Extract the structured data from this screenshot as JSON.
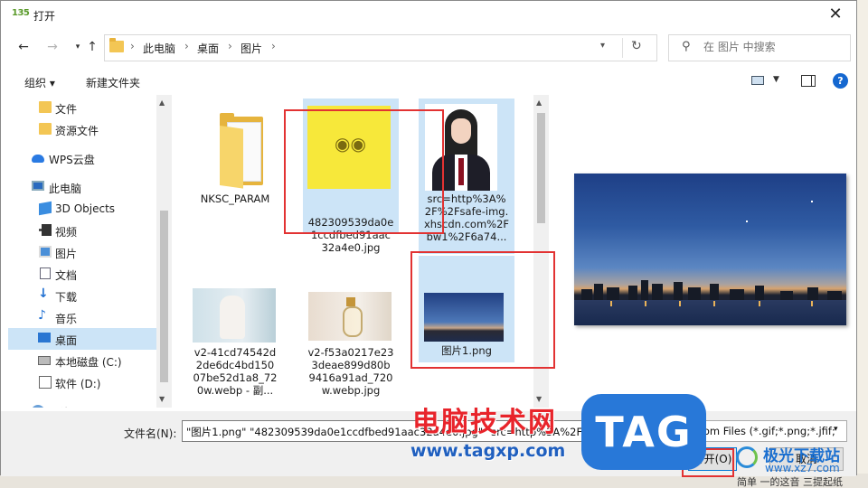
{
  "window": {
    "app_icon_text": "135",
    "title": "打开"
  },
  "breadcrumb": [
    "此电脑",
    "桌面",
    "图片"
  ],
  "search": {
    "placeholder": "在 图片 中搜索"
  },
  "toolbar": {
    "organize": "组织 ▾",
    "new_folder": "新建文件夹"
  },
  "sidebar": {
    "items": [
      {
        "label": "文件",
        "icon": "folder-icon"
      },
      {
        "label": "资源文件",
        "icon": "folder-icon"
      },
      {
        "label": "WPS云盘",
        "icon": "cloud-icon"
      },
      {
        "label": "此电脑",
        "icon": "computer-icon"
      },
      {
        "label": "3D Objects",
        "icon": "cube-icon"
      },
      {
        "label": "视频",
        "icon": "video-icon"
      },
      {
        "label": "图片",
        "icon": "picture-icon"
      },
      {
        "label": "文档",
        "icon": "document-icon"
      },
      {
        "label": "下载",
        "icon": "download-icon"
      },
      {
        "label": "音乐",
        "icon": "music-icon"
      },
      {
        "label": "桌面",
        "icon": "desktop-icon",
        "selected": true
      },
      {
        "label": "本地磁盘 (C:)",
        "icon": "drive-icon"
      },
      {
        "label": "软件 (D:)",
        "icon": "drive-icon"
      },
      {
        "label": "网络",
        "icon": "network-icon"
      }
    ]
  },
  "files": [
    {
      "name": "NKSC_PARAM",
      "type": "folder",
      "selected": false
    },
    {
      "name": "482309539da0e1ccdfbed91aac32a4e0.jpg",
      "display": "482309539da0e\n1ccdfbed91aac\n32a4e0.jpg",
      "type": "image",
      "selected": true
    },
    {
      "name": "src=http%3A%2F%2Fsafe-img.xhscdn.com%2Fbw1%2F6a74...",
      "display": "src=http%3A%\n2F%2Fsafe-img.\nxhscdn.com%2F\nbw1%2F6a74...",
      "type": "image",
      "selected": true
    },
    {
      "name": "v2-41cd74542d2de6dc4bd15007be52d1a8_720w.webp - 副...",
      "display": "v2-41cd74542d\n2de6dc4bd150\n07be52d1a8_72\n0w.webp - 副...",
      "type": "image",
      "selected": false
    },
    {
      "name": "v2-f53a0217e233deae899d80b9416a91ad_720w.webp",
      "display": "v2-f53a0217e23\n3deae899d80b\n9416a91ad_720\nw.webp.jpg",
      "type": "image",
      "selected": false
    },
    {
      "name": "图片1.png",
      "display": "图片1.png",
      "type": "image",
      "selected": true
    }
  ],
  "bottom": {
    "filename_label": "文件名(N):",
    "filename_value": "\"图片1.png\" \"482309539da0e1ccdfbed91aac32a4e0.jpg\" \"src=http%3A%2F%2Fsafe-img.",
    "filter_value": "Custom Files (*.gif;*.png;*.jfif;",
    "open_button": "打开(O)",
    "cancel_button": "取消"
  },
  "background": {
    "bottom_text": "简单 一的这音 三提起纸"
  },
  "watermarks": {
    "site_name_cn": "电脑技术网",
    "site_url": "www.tagxp.com",
    "tag": "TAG",
    "jg_name": "极光下载站",
    "jg_url": "www.xz7.com"
  },
  "colors": {
    "selection": "#cce4f7",
    "highlight_box": "#e23232",
    "accent": "#0078d7"
  }
}
